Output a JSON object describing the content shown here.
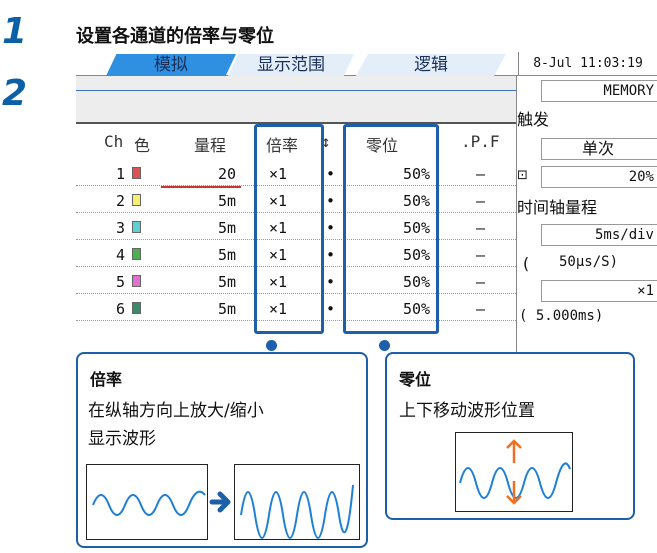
{
  "steps": [
    "1",
    "2"
  ],
  "heading": "设置各通道的倍率与零位",
  "tabs": [
    "模拟",
    "显示范围",
    "逻辑"
  ],
  "datetime": "8-Jul 11:03:19",
  "table": {
    "headers": {
      "ch": "Ch",
      "color": "色",
      "range": "量程",
      "scale": "倍率",
      "sep": "↕",
      "zero": "零位",
      "lpf": ".P.F"
    },
    "rows": [
      {
        "ch": "1",
        "color": "#e05050",
        "range": "20",
        "scale": "×1",
        "dot": "•",
        "zero": "50%",
        "lpf": "–"
      },
      {
        "ch": "2",
        "color": "#f5f070",
        "range": "5m",
        "scale": "×1",
        "dot": "•",
        "zero": "50%",
        "lpf": "–"
      },
      {
        "ch": "3",
        "color": "#5fd0d0",
        "range": "5m",
        "scale": "×1",
        "dot": "•",
        "zero": "50%",
        "lpf": "–"
      },
      {
        "ch": "4",
        "color": "#4caf50",
        "range": "5m",
        "scale": "×1",
        "dot": "•",
        "zero": "50%",
        "lpf": "–"
      },
      {
        "ch": "5",
        "color": "#e070d0",
        "range": "5m",
        "scale": "×1",
        "dot": "•",
        "zero": "50%",
        "lpf": "–"
      },
      {
        "ch": "6",
        "color": "#3a8a6a",
        "range": "5m",
        "scale": "×1",
        "dot": "•",
        "zero": "50%",
        "lpf": "–"
      }
    ]
  },
  "right_panel": {
    "mode": "MEMORY",
    "trigger_label": "触发",
    "trigger_value": "单次",
    "pretrigger_value": "20%",
    "timebase_label": "时间轴量程",
    "timebase_value": "5ms/div",
    "sampling_paren": "(",
    "sampling_value": "50μs/S)",
    "multiplier_value": "×1",
    "record_length": "( 5.000ms)"
  },
  "callouts": {
    "scale": {
      "title": "倍率",
      "text1": "在纵轴方向上放大/缩小",
      "text2": "显示波形"
    },
    "zero": {
      "title": "零位",
      "text1": "上下移动波形位置"
    }
  },
  "colors": {
    "accent": "#1d5fa8",
    "tab_active": "#2f8fe0",
    "wave": "#1e7fd6",
    "arrow": "#f07020"
  }
}
